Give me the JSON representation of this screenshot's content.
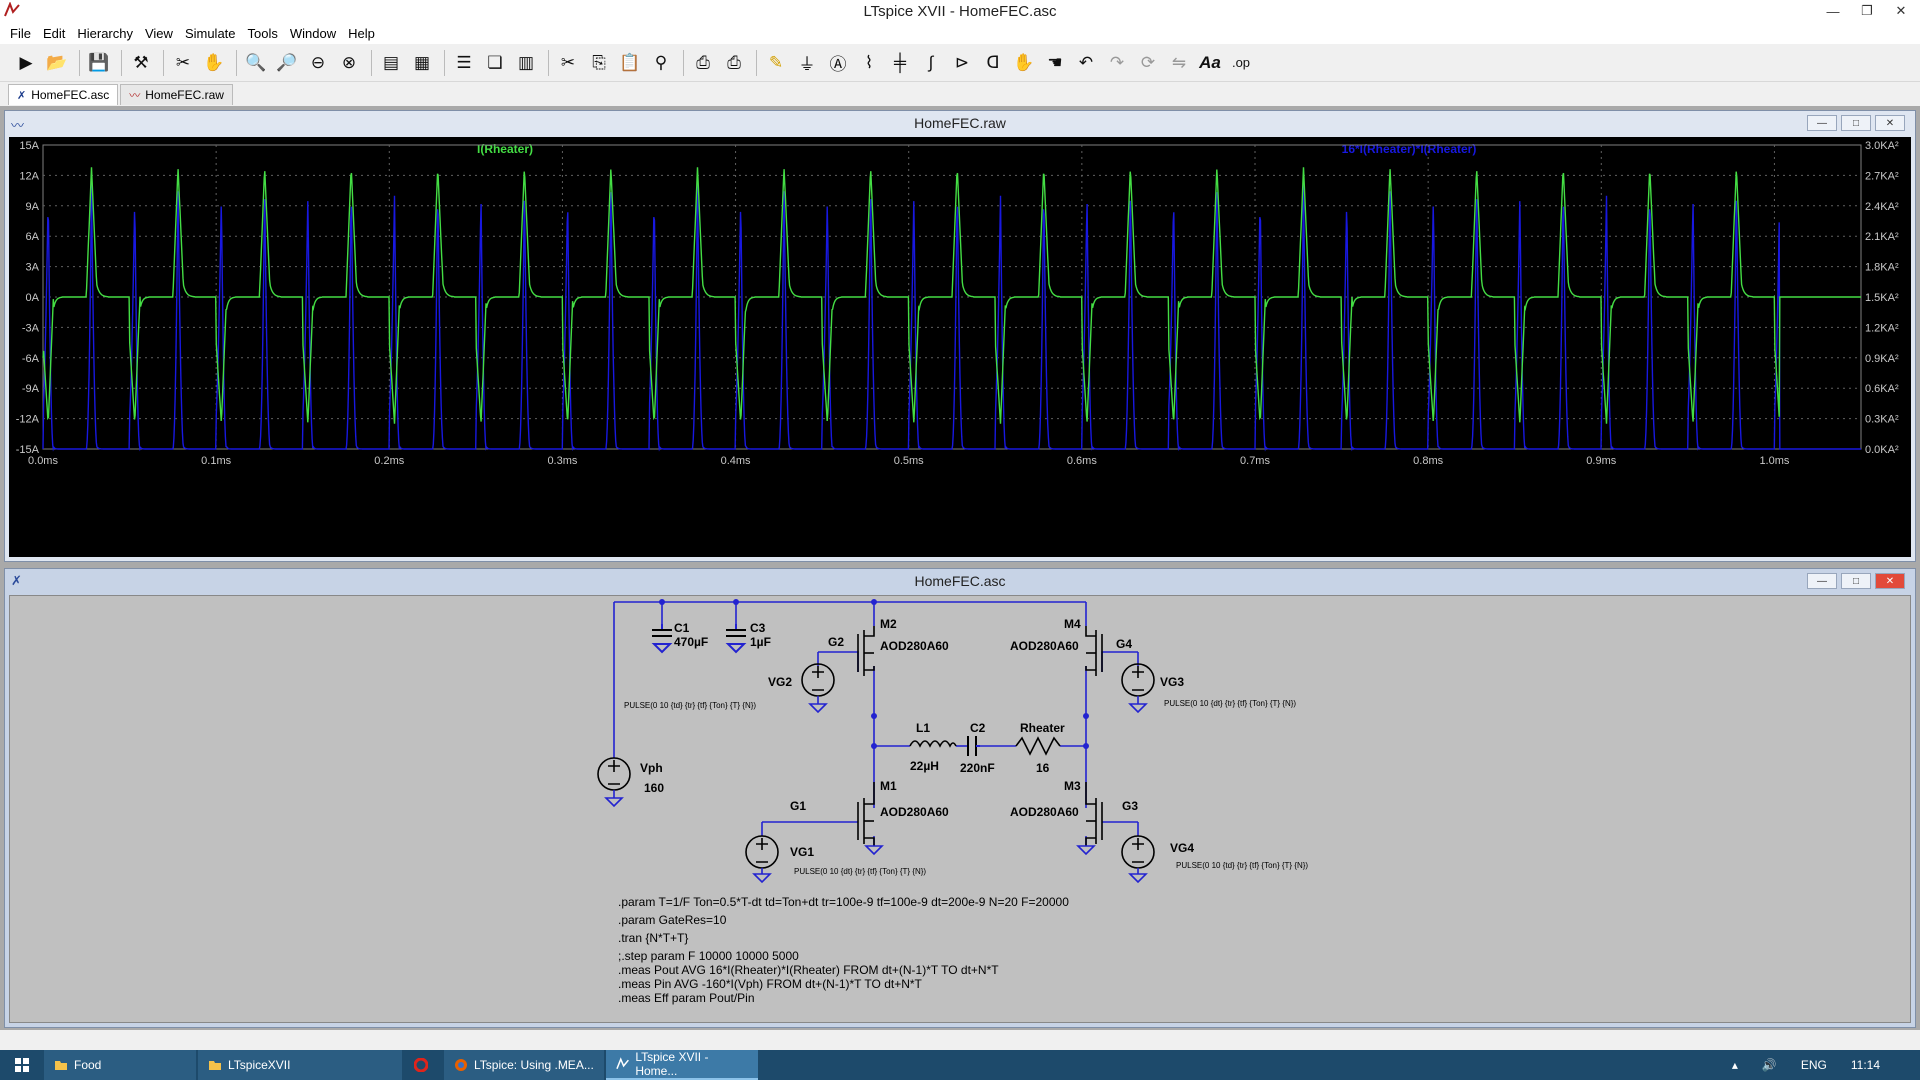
{
  "window": {
    "title": "LTspice XVII - HomeFEC.asc"
  },
  "menu": [
    "File",
    "Edit",
    "Hierarchy",
    "View",
    "Simulate",
    "Tools",
    "Window",
    "Help"
  ],
  "toolbar_icons": [
    "run-icon",
    "open-icon",
    "save-icon",
    "control-panel-icon",
    "halt-icon",
    "pan-hand-icon",
    "zoom-in-icon",
    "zoom-out-icon",
    "zoom-back-icon",
    "zoom-fit-icon",
    "autorange-icon",
    "grid-icon",
    "tile-horizontal-icon",
    "cascade-icon",
    "tile-vertical-icon",
    "cut-icon",
    "copy-icon",
    "paste-icon",
    "find-icon",
    "print-icon",
    "print-preview-icon",
    "wire-icon",
    "ground-icon",
    "label-icon",
    "resistor-icon",
    "capacitor-icon",
    "inductor-icon",
    "diode-icon",
    "component-icon",
    "move-icon",
    "drag-icon",
    "undo-icon",
    "redo-icon",
    "rotate-icon",
    "mirror-icon",
    "text-icon",
    "spice-directive-icon"
  ],
  "tabs": [
    {
      "label": "HomeFEC.asc",
      "icon": "schematic-icon",
      "active": true
    },
    {
      "label": "HomeFEC.raw",
      "icon": "waveform-icon",
      "active": false
    }
  ],
  "waveform_window": {
    "title": "HomeFEC.raw",
    "trace1_label": "I(Rheater)",
    "trace2_label": "16*I(Rheater)*I(Rheater)",
    "trace1_color": "#44dd44",
    "trace2_color": "#1818e0"
  },
  "chart_data": {
    "type": "line",
    "title": "",
    "x_ticks": [
      "0.0ms",
      "0.1ms",
      "0.2ms",
      "0.3ms",
      "0.4ms",
      "0.5ms",
      "0.6ms",
      "0.7ms",
      "0.8ms",
      "0.9ms",
      "1.0ms"
    ],
    "y_left_ticks": [
      "15A",
      "12A",
      "9A",
      "6A",
      "3A",
      "0A",
      "-3A",
      "-6A",
      "-9A",
      "-12A",
      "-15A"
    ],
    "y_right_ticks": [
      "3.0KA²",
      "2.7KA²",
      "2.4KA²",
      "2.1KA²",
      "1.8KA²",
      "1.5KA²",
      "1.2KA²",
      "0.9KA²",
      "0.6KA²",
      "0.3KA²",
      "0.0KA²"
    ],
    "xlim_ms": [
      0,
      1.05
    ],
    "ylim_left_A": [
      -15,
      15
    ],
    "ylim_right_KA2": [
      0,
      3.0
    ],
    "period_ms": 0.05,
    "pulse_count": 20,
    "series": [
      {
        "name": "I(Rheater)",
        "axis": "left",
        "peak_A": 12.8,
        "trough_A": -12.5,
        "settle_A": 0.0
      },
      {
        "name": "16*I(Rheater)*I(Rheater)",
        "axis": "right",
        "peak_KA2": 2.7,
        "base_KA2": 0.0
      }
    ],
    "grid": true
  },
  "schematic_window": {
    "title": "HomeFEC.asc",
    "components": {
      "c1_name": "C1",
      "c1_value": "470µF",
      "c3_name": "C3",
      "c3_value": "1µF",
      "m2_name": "M2",
      "m2_value": "AOD280A60",
      "m4_name": "M4",
      "m4_value": "AOD280A60",
      "m1_name": "M1",
      "m1_value": "AOD280A60",
      "m3_name": "M3",
      "m3_value": "AOD280A60",
      "g1": "G1",
      "g2": "G2",
      "g3": "G3",
      "g4": "G4",
      "vg1": "VG1",
      "vg2": "VG2",
      "vg3": "VG3",
      "vg4": "VG4",
      "vg1_value": "PULSE(0 10 {dt} {tr} {tf} {Ton} {T} {N})",
      "vg2_value": "PULSE(0 10 {td} {tr} {tf} {Ton} {T} {N})",
      "vg3_value": "PULSE(0 10 {dt} {tr} {tf} {Ton} {T} {N})",
      "vg4_value": "PULSE(0 10 {td} {tr} {tf} {Ton} {T} {N})",
      "vph_name": "Vph",
      "vph_value": "160",
      "l1_name": "L1",
      "l1_value": "22µH",
      "c2_name": "C2",
      "c2_value": "220nF",
      "rheater_name": "Rheater",
      "rheater_value": "16"
    },
    "directives": [
      ".param T=1/F Ton=0.5*T-dt td=Ton+dt tr=100e-9 tf=100e-9 dt=200e-9 N=20 F=20000",
      ".param GateRes=10",
      ".tran {N*T+T}",
      ";.step param F 10000 10000 5000",
      ".meas Pout AVG 16*I(Rheater)*I(Rheater) FROM dt+(N-1)*T TO dt+N*T",
      ".meas Pin AVG -160*I(Vph) FROM dt+(N-1)*T TO dt+N*T",
      ".meas Eff param Pout/Pin"
    ]
  },
  "taskbar": {
    "items": [
      {
        "label": "Food",
        "icon": "folder-icon"
      },
      {
        "label": "LTspiceXVII",
        "icon": "folder-icon"
      },
      {
        "label": "",
        "icon": "opera-icon"
      },
      {
        "label": "LTspice: Using .MEA...",
        "icon": "firefox-icon"
      },
      {
        "label": "LTspice XVII - Home...",
        "icon": "ltspice-icon"
      }
    ],
    "lang": "ENG",
    "time": "11:14"
  }
}
